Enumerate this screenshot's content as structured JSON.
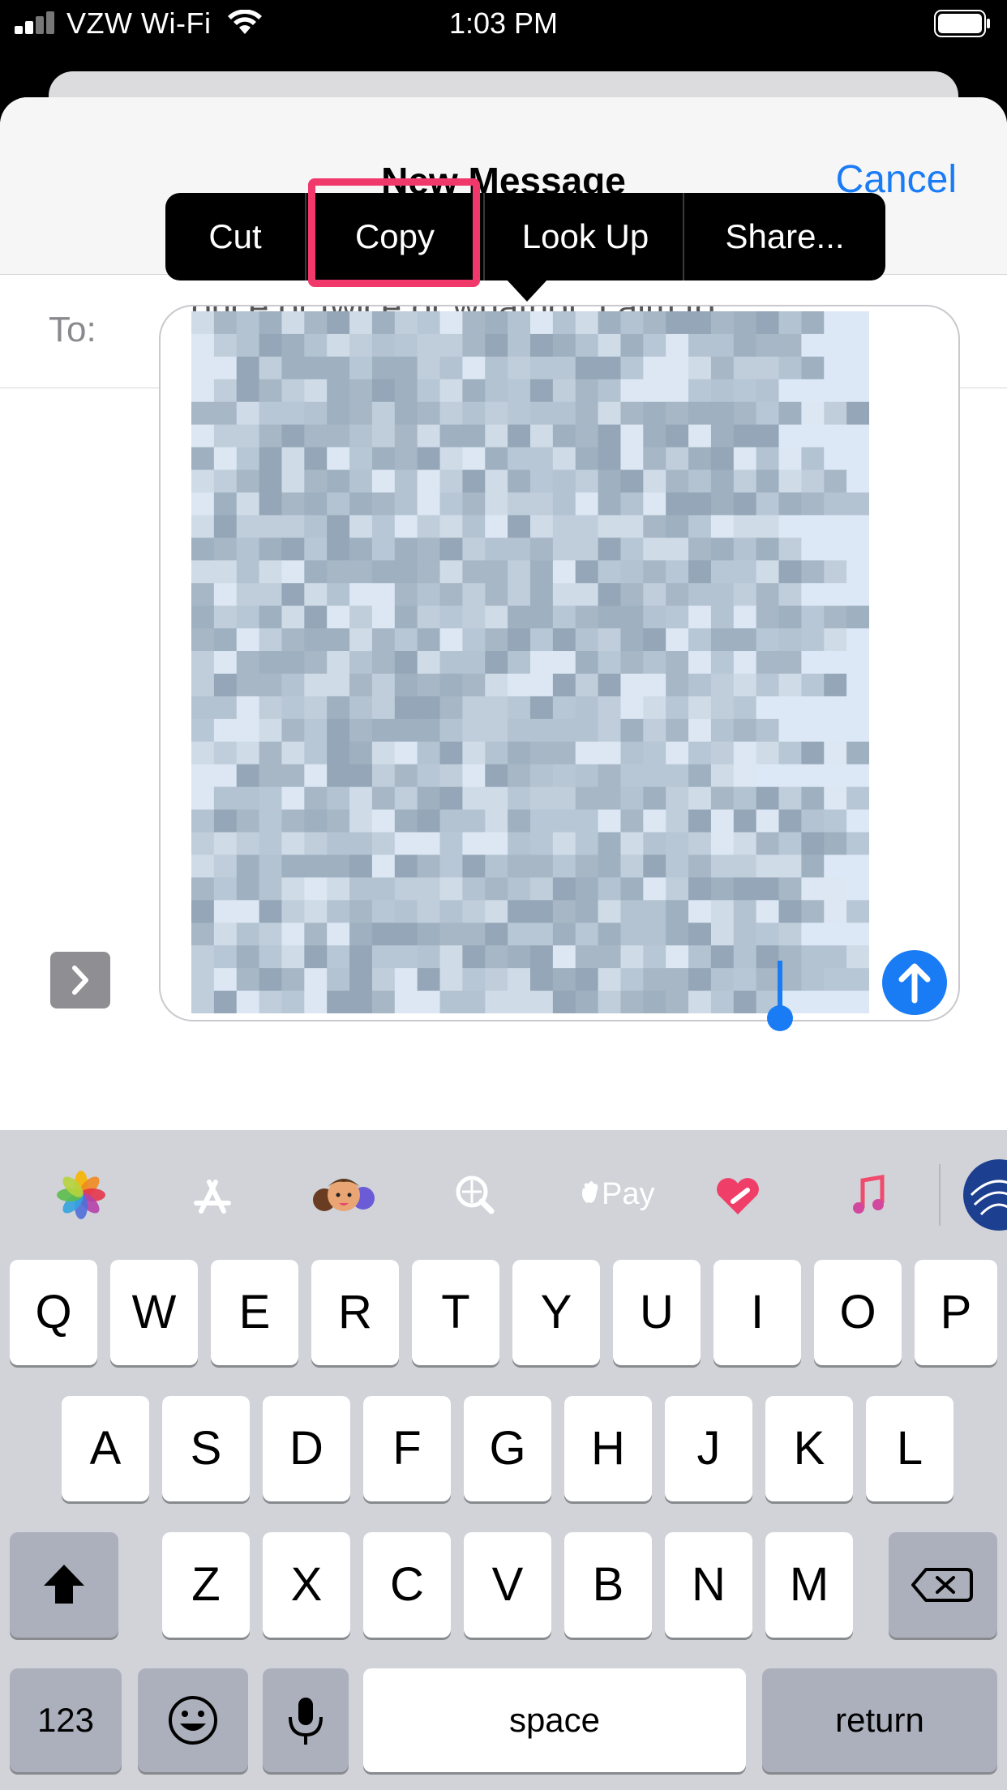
{
  "status_bar": {
    "carrier": "VZW Wi-Fi",
    "time": "1:03 PM"
  },
  "header": {
    "title": "New Message",
    "cancel": "Cancel"
  },
  "to_row": {
    "label": "To:"
  },
  "message": {
    "visible_text": "once or twice or whatnot. I aim to"
  },
  "context_menu": {
    "items": [
      "Cut",
      "Copy",
      "Look Up",
      "Share..."
    ],
    "highlighted": "Copy"
  },
  "app_strip": {
    "apps": [
      {
        "name": "photos-app-icon",
        "color": "#ffffff"
      },
      {
        "name": "app-store-app-icon",
        "color": "#1d8ff0"
      },
      {
        "name": "memoji-app-icon",
        "color": "#ffffff"
      },
      {
        "name": "web-search-app-icon",
        "color": "#ee3c6b"
      },
      {
        "name": "apple-pay-app-icon",
        "color": "#161616",
        "label": "Pay"
      },
      {
        "name": "digital-touch-app-icon",
        "color": "#000000"
      },
      {
        "name": "music-app-icon",
        "color": "#ffffff"
      }
    ]
  },
  "keyboard": {
    "row1": [
      "Q",
      "W",
      "E",
      "R",
      "T",
      "Y",
      "U",
      "I",
      "O",
      "P"
    ],
    "row2": [
      "A",
      "S",
      "D",
      "F",
      "G",
      "H",
      "J",
      "K",
      "L"
    ],
    "row3": [
      "Z",
      "X",
      "C",
      "V",
      "B",
      "N",
      "M"
    ],
    "numbers": "123",
    "space": "space",
    "return": "return"
  },
  "colors": {
    "accent": "#1a7cf5",
    "highlight": "#f0386b"
  }
}
